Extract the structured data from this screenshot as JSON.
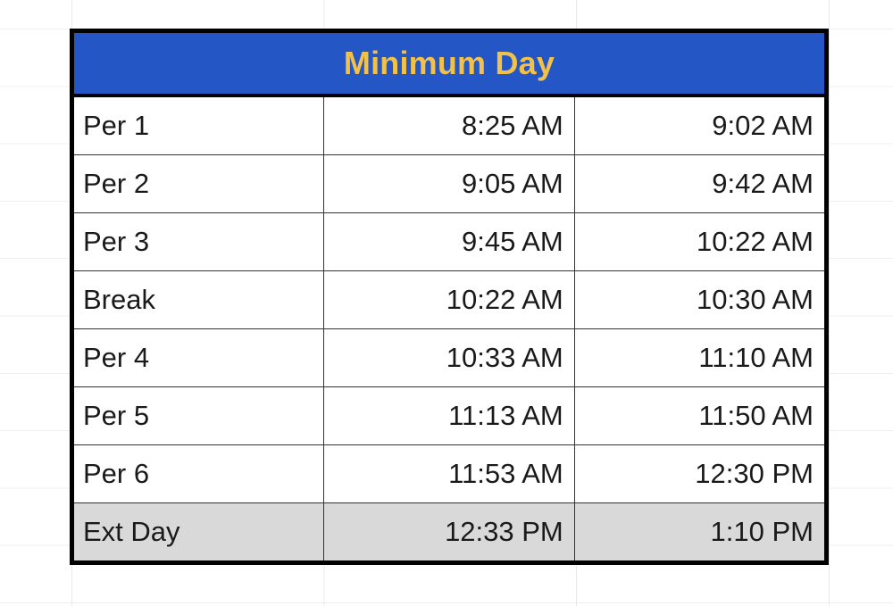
{
  "header": {
    "title": "Minimum Day",
    "background_color": "#2456C6",
    "text_color": "#F2C14A"
  },
  "table": {
    "shaded_row_color": "#D9D9D9",
    "border_color": "#000000",
    "columns": [
      "period",
      "start_time",
      "end_time"
    ],
    "rows": [
      {
        "period": "Per 1",
        "start_time": "8:25 AM",
        "end_time": "9:02 AM",
        "shaded": false
      },
      {
        "period": "Per 2",
        "start_time": "9:05 AM",
        "end_time": "9:42 AM",
        "shaded": false
      },
      {
        "period": "Per 3",
        "start_time": "9:45 AM",
        "end_time": "10:22 AM",
        "shaded": false
      },
      {
        "period": "Break",
        "start_time": "10:22 AM",
        "end_time": "10:30 AM",
        "shaded": false
      },
      {
        "period": "Per 4",
        "start_time": "10:33 AM",
        "end_time": "11:10 AM",
        "shaded": false
      },
      {
        "period": "Per 5",
        "start_time": "11:13 AM",
        "end_time": "11:50 AM",
        "shaded": false
      },
      {
        "period": "Per 6",
        "start_time": "11:53 AM",
        "end_time": "12:30 PM",
        "shaded": false
      },
      {
        "period": "Ext Day",
        "start_time": "12:33 PM",
        "end_time": "1:10 PM",
        "shaded": true
      }
    ]
  }
}
